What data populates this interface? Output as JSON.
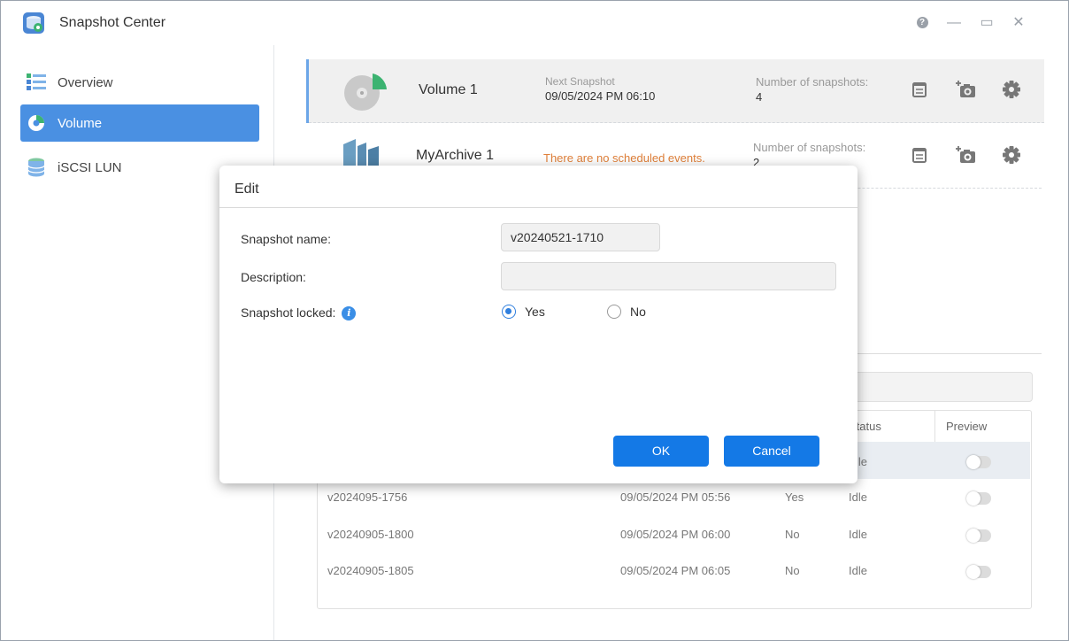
{
  "app": {
    "title": "Snapshot Center",
    "icon": "snapshot-center-icon"
  },
  "window_controls": {
    "help": "?",
    "minimize": "—",
    "maximize": "▭",
    "close": "✕"
  },
  "sidebar": {
    "items": [
      {
        "label": "Overview",
        "icon": "overview-icon",
        "active": false
      },
      {
        "label": "Volume",
        "icon": "volume-icon",
        "active": true
      },
      {
        "label": "iSCSI LUN",
        "icon": "database-icon",
        "active": false
      }
    ]
  },
  "volumes": [
    {
      "name": "Volume 1",
      "next_label": "Next Snapshot",
      "next_value": "09/05/2024 PM 06:10",
      "count_label": "Number of snapshots:",
      "count_value": "4"
    },
    {
      "name": "MyArchive 1",
      "schedule_note": "There are no scheduled events.",
      "count_label": "Number of snapshots:",
      "count_value": "2"
    }
  ],
  "table": {
    "headers": {
      "status": "Status",
      "preview": "Preview"
    },
    "rows": [
      {
        "status": "Idle"
      },
      {
        "name": "v2024095-1756",
        "time": "09/05/2024 PM 05:56",
        "locked": "Yes",
        "status": "Idle"
      },
      {
        "name": "v20240905-1800",
        "time": "09/05/2024 PM 06:00",
        "locked": "No",
        "status": "Idle"
      },
      {
        "name": "v20240905-1805",
        "time": "09/05/2024 PM 06:05",
        "locked": "No",
        "status": "Idle"
      }
    ]
  },
  "dialog": {
    "title": "Edit",
    "snapshot_name_label": "Snapshot name:",
    "snapshot_name_value": "v20240521-1710",
    "description_label": "Description:",
    "description_value": "",
    "locked_label": "Snapshot locked:",
    "options": {
      "yes": "Yes",
      "no": "No",
      "selected": "Yes"
    },
    "ok": "OK",
    "cancel": "Cancel"
  },
  "colors": {
    "accent": "#1479e6",
    "sidebar_active": "#4a90e2",
    "warning_text": "#e0803a"
  }
}
